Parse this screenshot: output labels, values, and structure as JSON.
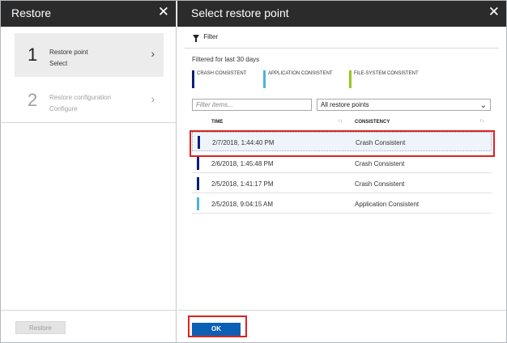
{
  "left_blade": {
    "title": "Restore",
    "close_icon": "close-icon",
    "steps": [
      {
        "number": "1",
        "title": "Restore point",
        "subtitle": "Select",
        "state": "active"
      },
      {
        "number": "2",
        "title": "Restore configuration",
        "subtitle": "Configure",
        "state": "disabled"
      }
    ],
    "restore_button": "Restore"
  },
  "right_blade": {
    "title": "Select restore point",
    "close_icon": "close-icon",
    "filter_label": "Filter",
    "filter_icon": "filter-icon",
    "filtered_text": "Filtered for last 30 days",
    "legend": [
      {
        "label": "CRASH CONSISTENT",
        "color": "#0b1f7a"
      },
      {
        "label": "APPLICATION CONSISTENT",
        "color": "#4cb3e0"
      },
      {
        "label": "FILE-SYSTEM CONSISTENT",
        "color": "#9ac31c"
      }
    ],
    "search": {
      "placeholder": "Filter items..."
    },
    "select": {
      "value": "All restore points"
    },
    "columns": {
      "time": "TIME",
      "consistency": "CONSISTENCY"
    },
    "rows": [
      {
        "time": "2/7/2018, 1:44:40 PM",
        "consistency": "Crash Consistent",
        "color": "#0b1f7a",
        "selected": true
      },
      {
        "time": "2/6/2018, 1:45:48 PM",
        "consistency": "Crash Consistent",
        "color": "#0b1f7a",
        "selected": false
      },
      {
        "time": "2/5/2018, 1:41:17 PM",
        "consistency": "Crash Consistent",
        "color": "#0b1f7a",
        "selected": false
      },
      {
        "time": "2/5/2018, 9:04:15 AM",
        "consistency": "Application Consistent",
        "color": "#4cb3e0",
        "selected": false
      }
    ],
    "ok_button": "OK"
  }
}
